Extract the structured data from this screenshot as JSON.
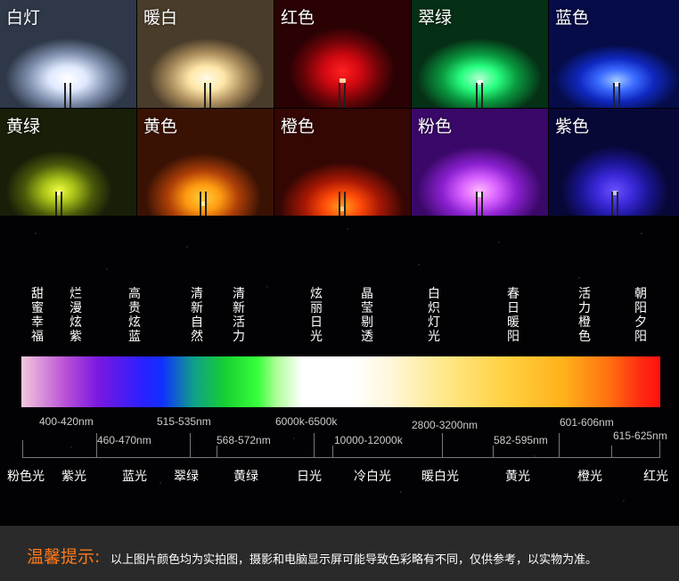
{
  "tiles": [
    {
      "label": "白灯",
      "color": "#e8f2ff"
    },
    {
      "label": "暖白",
      "color": "#fff1c8"
    },
    {
      "label": "红色",
      "color": "#ff1818"
    },
    {
      "label": "翠绿",
      "color": "#22ff7a"
    },
    {
      "label": "蓝色",
      "color": "#2a5bff"
    },
    {
      "label": "黄绿",
      "color": "#c8e81a"
    },
    {
      "label": "黄色",
      "color": "#ff9a10"
    },
    {
      "label": "橙色",
      "color": "#ff4a08"
    },
    {
      "label": "粉色",
      "color": "#e070ff"
    },
    {
      "label": "紫色",
      "color": "#4a30ff"
    }
  ],
  "descriptions": [
    "甜蜜幸福",
    "烂漫炫紫",
    "高贵炫蓝",
    "清新自然",
    "清新活力",
    "炫丽日光",
    "晶莹剔透",
    "白炽灯光",
    "春日暖阳",
    "活力橙色",
    "朝阳夕阳"
  ],
  "wavelengths_upper": [
    "400-420nm",
    "515-535nm",
    "6000k-6500k",
    "2800-3200nm",
    "601-606nm"
  ],
  "wavelengths_lower": [
    "460-470nm",
    "568-572nm",
    "10000-12000k",
    "582-595nm",
    "615-625nm"
  ],
  "color_names": [
    "粉色光",
    "紫光",
    "蓝光",
    "翠绿",
    "黄绿",
    "日光",
    "冷白光",
    "暖白光",
    "黄光",
    "橙光",
    "红光"
  ],
  "footer": {
    "title": "温馨提示:",
    "text": "以上图片颜色均为实拍图，摄影和电脑显示屏可能导致色彩略有不同，仅供参考，以实物为准。"
  }
}
